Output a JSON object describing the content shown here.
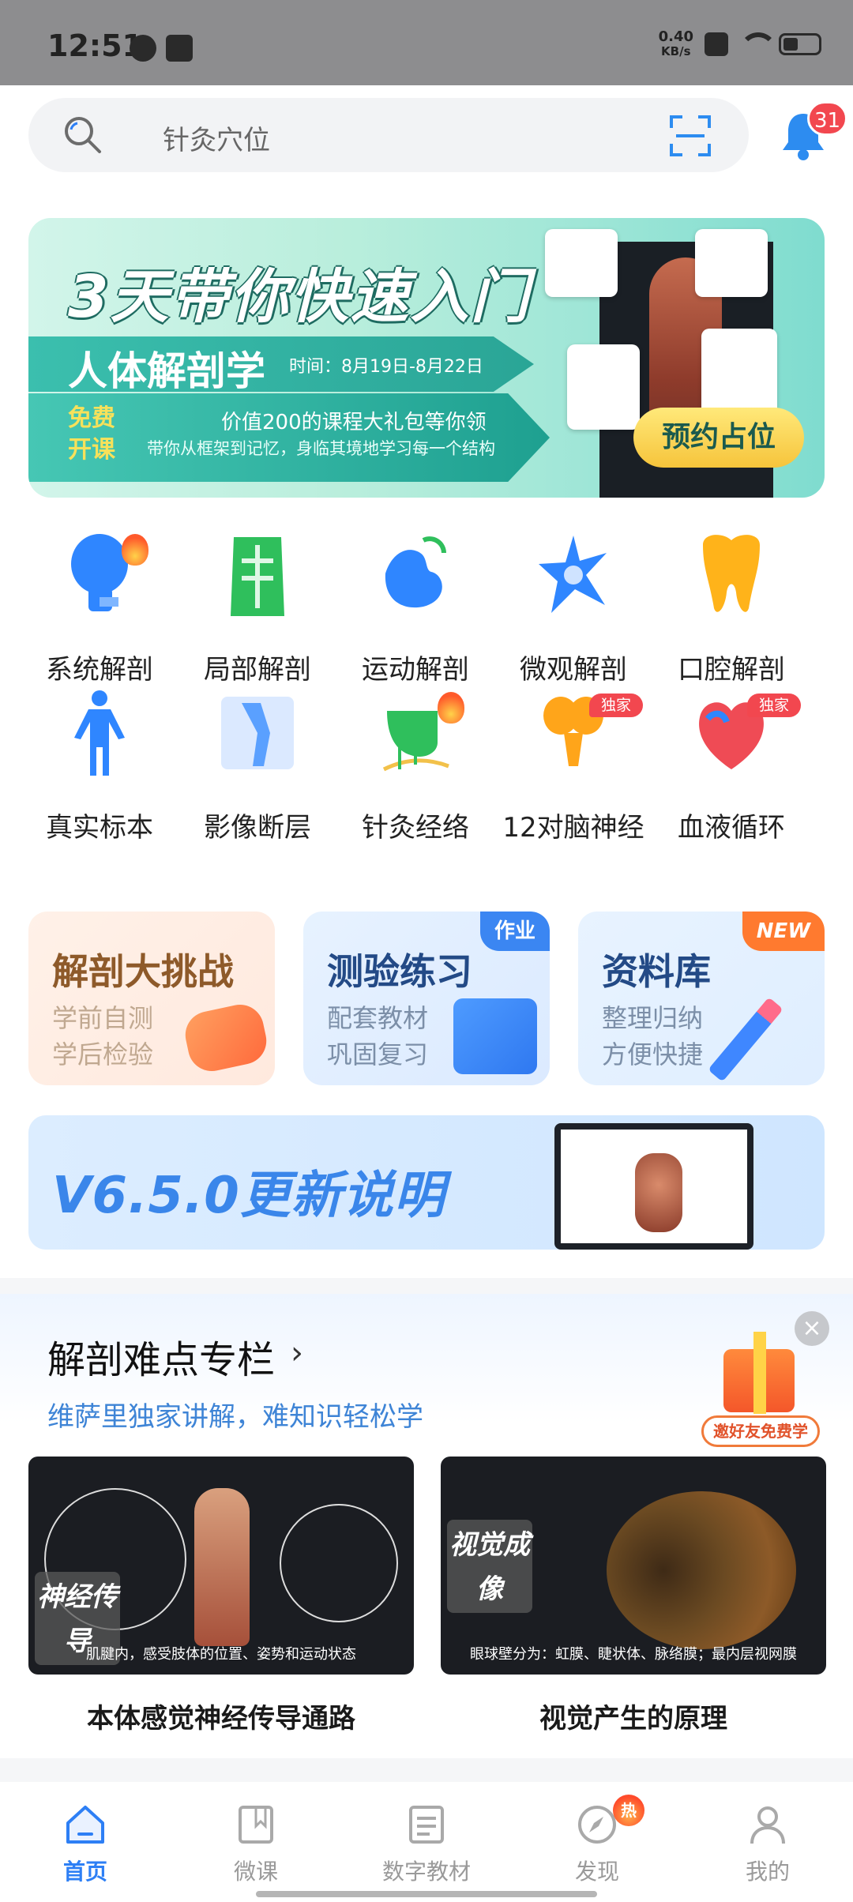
{
  "status_bar": {
    "time": "12:51",
    "net_speed_value": "0.40",
    "net_speed_unit": "KB/s"
  },
  "search": {
    "placeholder": "针灸穴位",
    "notification_count": "31"
  },
  "banner": {
    "headline": "3天带你快速入门",
    "subject": "人体解剖学",
    "date": "时间：8月19日-8月22日",
    "free_label": "免费开课",
    "line1": "价值200的课程大礼包等你领",
    "line2": "带你从框架到记忆，身临其境地学习每一个结构",
    "cta": "预约占位"
  },
  "categories": [
    {
      "label": "系统解剖",
      "icon": "skull-icon",
      "color": "#2f86ff",
      "badge": "hot"
    },
    {
      "label": "局部解剖",
      "icon": "torso-icon",
      "color": "#2fbf5c",
      "badge": ""
    },
    {
      "label": "运动解剖",
      "icon": "muscle-arm-icon",
      "color": "#2f86ff",
      "badge": ""
    },
    {
      "label": "微观解剖",
      "icon": "neuron-cell-icon",
      "color": "#2f86ff",
      "badge": ""
    },
    {
      "label": "口腔解剖",
      "icon": "tooth-icon",
      "color": "#ffb31a",
      "badge": ""
    },
    {
      "label": "真实标本",
      "icon": "human-figure-icon",
      "color": "#2f86ff",
      "badge": ""
    },
    {
      "label": "影像断层",
      "icon": "xray-knee-icon",
      "color": "#5aa0ff",
      "badge": ""
    },
    {
      "label": "针灸经络",
      "icon": "acupuncture-hand-icon",
      "color": "#2fbf5c",
      "badge": "hot"
    },
    {
      "label": "12对脑神经",
      "icon": "brain-nerve-icon",
      "color": "#ffa51a",
      "badge": "独家"
    },
    {
      "label": "血液循环",
      "icon": "heart-icon",
      "color": "#ef4b55",
      "badge": "独家"
    }
  ],
  "features": [
    {
      "title": "解剖大挑战",
      "line1": "学前自测",
      "line2": "学后检验",
      "tag": ""
    },
    {
      "title": "测验练习",
      "line1": "配套教材",
      "line2": "巩固复习",
      "tag": "作业"
    },
    {
      "title": "资料库",
      "line1": "整理归纳",
      "line2": "方便快捷",
      "tag": "NEW"
    }
  ],
  "update_banner": {
    "text": "V6.5.0更新说明"
  },
  "special_column": {
    "title": "解剖难点专栏",
    "subtitle": "维萨里独家讲解，难知识轻松学",
    "gift_label": "邀好友免费学",
    "videos": [
      {
        "name": "本体感觉神经传导通路",
        "tag": "神经传导",
        "caption": "肌腱内，感受肢体的位置、姿势和运动状态"
      },
      {
        "name": "视觉产生的原理",
        "tag": "视觉成像",
        "caption": "眼球壁分为：虹膜、睫状体、脉络膜；最内层视网膜"
      }
    ]
  },
  "bottom_nav": [
    {
      "label": "首页",
      "icon": "home-icon",
      "active": true
    },
    {
      "label": "微课",
      "icon": "book-icon",
      "active": false
    },
    {
      "label": "数字教材",
      "icon": "textbook-icon",
      "active": false
    },
    {
      "label": "发现",
      "icon": "compass-icon",
      "active": false,
      "badge": "热"
    },
    {
      "label": "我的",
      "icon": "user-icon",
      "active": false
    }
  ],
  "colors": {
    "accent": "#2d7ff5",
    "badge_red": "#f2474f",
    "banner_teal": "#2aa596"
  }
}
